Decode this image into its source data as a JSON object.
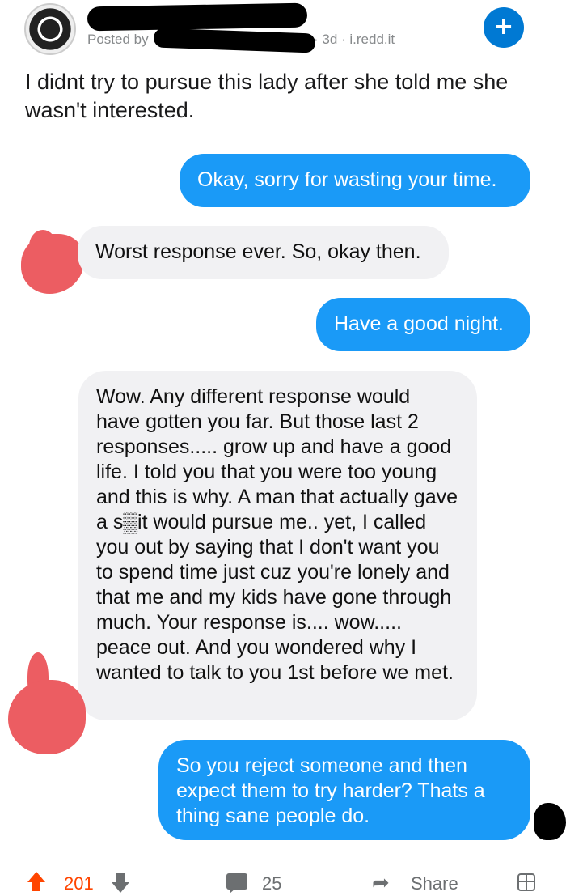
{
  "header": {
    "posted_by": "Posted by",
    "meta": "· 3d · i.redd.it",
    "add_icon": "plus-icon",
    "add_label": "+"
  },
  "post": {
    "title": "I didnt try to pursue this lady after she told me she wasn't interested."
  },
  "messages": [
    {
      "side": "sent",
      "text": "Okay, sorry for wasting your time."
    },
    {
      "side": "received",
      "text": "Worst response ever. So, okay then."
    },
    {
      "side": "sent",
      "text": "Have a good night."
    },
    {
      "side": "received",
      "text": "Wow. Any different response would have gotten you far. But those last 2 responses..... grow up and have a good life. I told you that you were too young and this is why. A man that actually gave a s▒it would pursue me.. yet, I called you out by saying that I don't want you to spend time just cuz you're lonely and that me and my kids have gone through much. Your response is.... wow..... peace out. And you wondered why I wanted to talk to you 1st before we met."
    },
    {
      "side": "sent",
      "text": "So you reject someone and then expect them to try harder? Thats a thing sane people do."
    }
  ],
  "actions": {
    "upvotes": "201",
    "comments": "25",
    "share_label": "Share",
    "share_icon": "➦"
  },
  "colors": {
    "sent_bubble": "#1a9af7",
    "received_bubble": "#f1f1f3",
    "upvote": "#ff4500",
    "reddit_blue": "#0079d3"
  }
}
